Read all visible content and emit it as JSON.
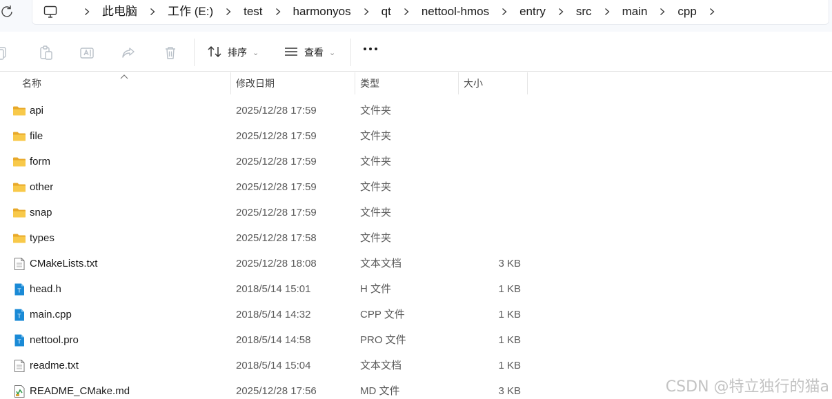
{
  "breadcrumb": [
    "此电脑",
    "工作 (E:)",
    "test",
    "harmonyos",
    "qt",
    "nettool-hmos",
    "entry",
    "src",
    "main",
    "cpp"
  ],
  "toolbar": {
    "sort_label": "排序",
    "view_label": "查看"
  },
  "columns": {
    "name": "名称",
    "date": "修改日期",
    "type": "类型",
    "size": "大小"
  },
  "files": [
    {
      "name": "api",
      "date": "2025/12/28 17:59",
      "type": "文件夹",
      "size": "",
      "icon": "folder-icon"
    },
    {
      "name": "file",
      "date": "2025/12/28 17:59",
      "type": "文件夹",
      "size": "",
      "icon": "folder-icon"
    },
    {
      "name": "form",
      "date": "2025/12/28 17:59",
      "type": "文件夹",
      "size": "",
      "icon": "folder-icon"
    },
    {
      "name": "other",
      "date": "2025/12/28 17:59",
      "type": "文件夹",
      "size": "",
      "icon": "folder-icon"
    },
    {
      "name": "snap",
      "date": "2025/12/28 17:59",
      "type": "文件夹",
      "size": "",
      "icon": "folder-icon"
    },
    {
      "name": "types",
      "date": "2025/12/28 17:58",
      "type": "文件夹",
      "size": "",
      "icon": "folder-icon"
    },
    {
      "name": "CMakeLists.txt",
      "date": "2025/12/28 18:08",
      "type": "文本文档",
      "size": "3 KB",
      "icon": "text-file-icon"
    },
    {
      "name": "head.h",
      "date": "2018/5/14 15:01",
      "type": "H 文件",
      "size": "1 KB",
      "icon": "code-file-icon"
    },
    {
      "name": "main.cpp",
      "date": "2018/5/14 14:32",
      "type": "CPP 文件",
      "size": "1 KB",
      "icon": "code-file-icon"
    },
    {
      "name": "nettool.pro",
      "date": "2018/5/14 14:58",
      "type": "PRO 文件",
      "size": "1 KB",
      "icon": "code-file-icon"
    },
    {
      "name": "readme.txt",
      "date": "2018/5/14 15:04",
      "type": "文本文档",
      "size": "1 KB",
      "icon": "text-file-icon"
    },
    {
      "name": "README_CMake.md",
      "date": "2025/12/28 17:56",
      "type": "MD 文件",
      "size": "3 KB",
      "icon": "markdown-file-icon"
    }
  ],
  "watermark": "CSDN @特立独行的猫a",
  "colors": {
    "folder": "#f8c94a",
    "folder_dark": "#e8a92a",
    "code_file": "#1a8ad6",
    "accent": "#0067c0"
  }
}
